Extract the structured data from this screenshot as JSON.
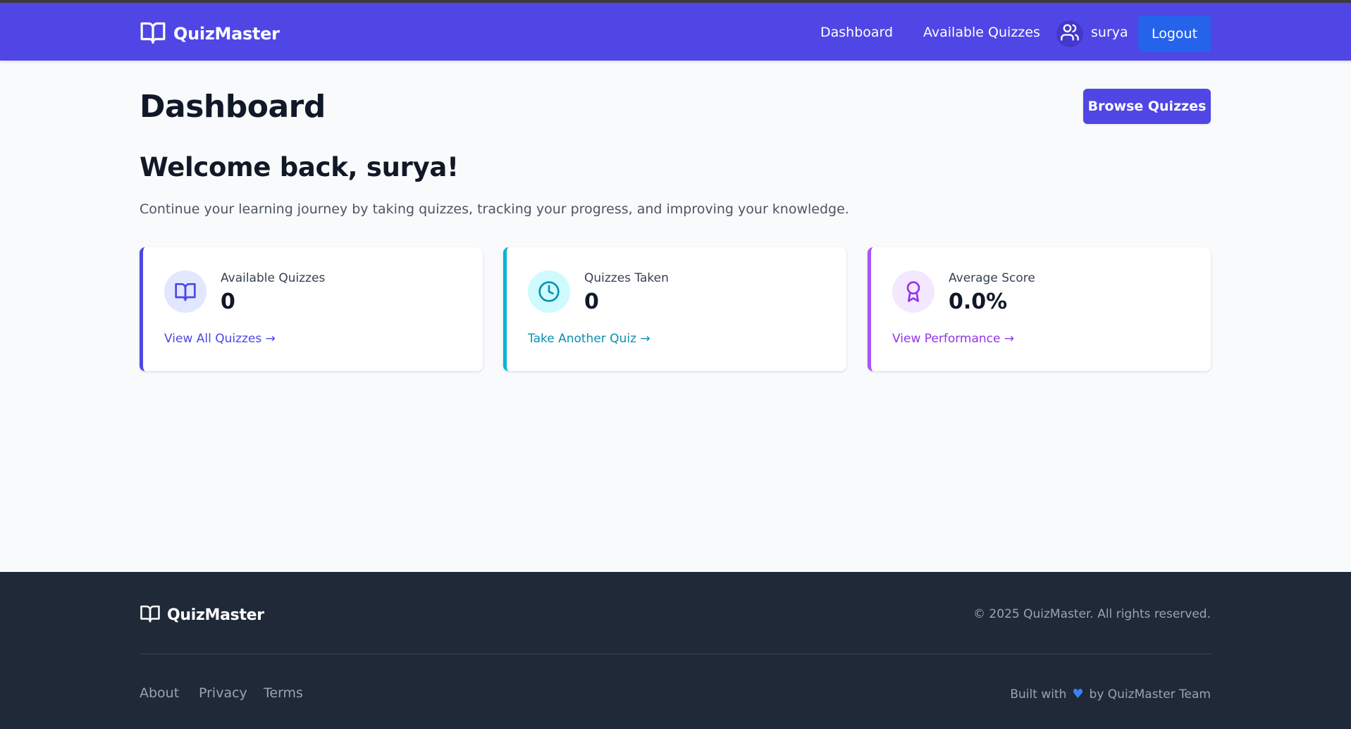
{
  "navbar": {
    "brand": "QuizMaster",
    "links": {
      "dashboard": "Dashboard",
      "available_quizzes": "Available Quizzes"
    },
    "user": "surya",
    "logout_label": "Logout"
  },
  "main": {
    "title": "Dashboard",
    "browse_label": "Browse Quizzes",
    "welcome": "Welcome back, surya!",
    "subtitle": "Continue your learning journey by taking quizzes, tracking your progress, and improving your knowledge.",
    "cards": [
      {
        "icon": "book-icon",
        "label": "Available Quizzes",
        "value": "0",
        "link": "View All Quizzes →"
      },
      {
        "icon": "clock-icon",
        "label": "Quizzes Taken",
        "value": "0",
        "link": "Take Another Quiz →"
      },
      {
        "icon": "award-icon",
        "label": "Average Score",
        "value": "0.0%",
        "link": "View Performance →"
      }
    ]
  },
  "footer": {
    "brand": "QuizMaster",
    "copyright": "© 2025 QuizMaster. All rights reserved.",
    "links": {
      "about": "About",
      "privacy": "Privacy",
      "terms": "Terms"
    },
    "built_prefix": "Built with",
    "built_suffix": "by QuizMaster Team"
  },
  "colors": {
    "primary": "#4f46e5",
    "logout": "#2563eb",
    "cyan": "#06b6d4",
    "purple": "#a855f7",
    "footer_bg": "#1f2937"
  }
}
